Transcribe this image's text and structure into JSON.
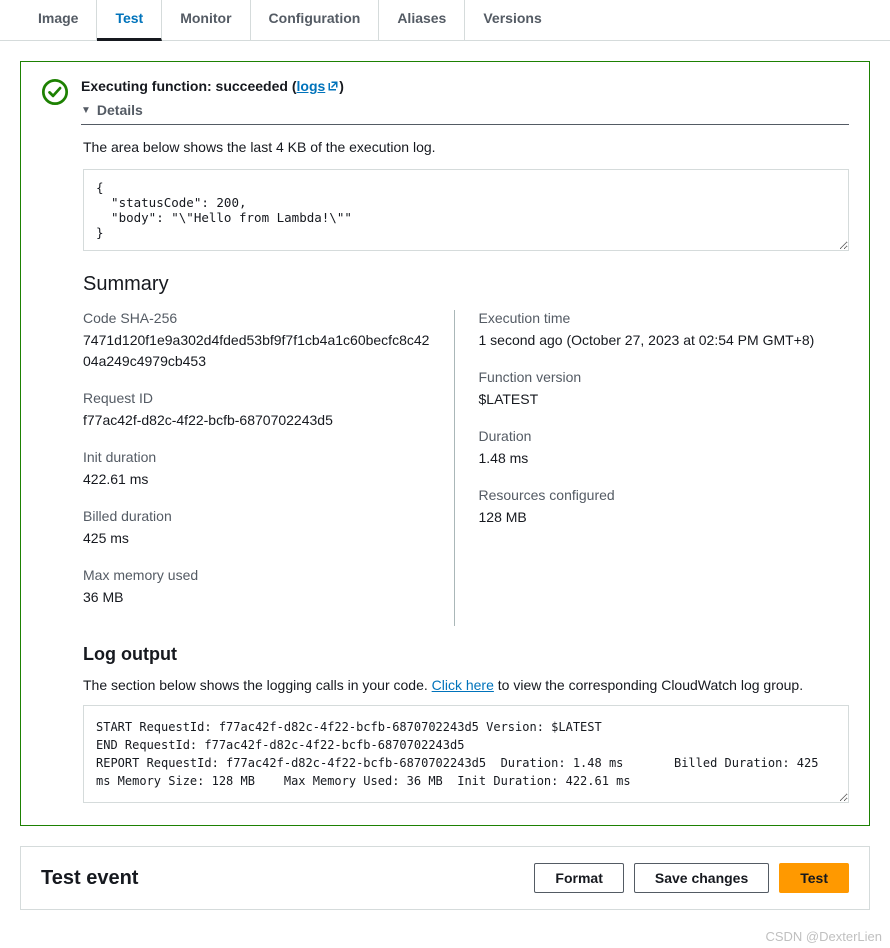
{
  "tabs": [
    "Image",
    "Test",
    "Monitor",
    "Configuration",
    "Aliases",
    "Versions"
  ],
  "activeTab": "Test",
  "status": {
    "prefix": "Executing function: succeeded",
    "logsLinkLabel": "logs"
  },
  "detailsLabel": "Details",
  "execLogDesc": "The area below shows the last 4 KB of the execution log.",
  "responseBody": "{\n  \"statusCode\": 200,\n  \"body\": \"\\\"Hello from Lambda!\\\"\"\n}",
  "summaryTitle": "Summary",
  "summaryLeft": [
    {
      "label": "Code SHA-256",
      "value": "7471d120f1e9a302d4fded53bf9f7f1cb4a1c60becfc8c4204a249c4979cb453"
    },
    {
      "label": "Request ID",
      "value": "f77ac42f-d82c-4f22-bcfb-6870702243d5"
    },
    {
      "label": "Init duration",
      "value": "422.61 ms"
    },
    {
      "label": "Billed duration",
      "value": "425 ms"
    },
    {
      "label": "Max memory used",
      "value": "36 MB"
    }
  ],
  "summaryRight": [
    {
      "label": "Execution time",
      "value": "1 second ago (October 27, 2023 at 02:54 PM GMT+8)"
    },
    {
      "label": "Function version",
      "value": "$LATEST"
    },
    {
      "label": "Duration",
      "value": "1.48 ms"
    },
    {
      "label": "Resources configured",
      "value": "128 MB"
    }
  ],
  "logOutputTitle": "Log output",
  "logOutputDescPre": "The section below shows the logging calls in your code. ",
  "logOutputLink": "Click here",
  "logOutputDescPost": " to view the corresponding CloudWatch log group.",
  "logOutputBody": "START RequestId: f77ac42f-d82c-4f22-bcfb-6870702243d5 Version: $LATEST\nEND RequestId: f77ac42f-d82c-4f22-bcfb-6870702243d5\nREPORT RequestId: f77ac42f-d82c-4f22-bcfb-6870702243d5  Duration: 1.48 ms       Billed Duration: 425 ms Memory Size: 128 MB    Max Memory Used: 36 MB  Init Duration: 422.61 ms",
  "testEvent": {
    "title": "Test event",
    "formatBtn": "Format",
    "saveBtn": "Save changes",
    "testBtn": "Test"
  },
  "watermark": "CSDN @DexterLien"
}
